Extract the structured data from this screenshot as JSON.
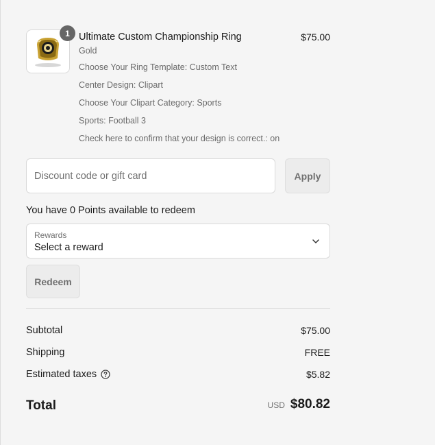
{
  "product": {
    "quantity": "1",
    "title": "Ultimate Custom Championship Ring",
    "variant": "Gold",
    "properties": [
      "Choose Your Ring Template: Custom Text",
      "Center Design: Clipart",
      "Choose Your Clipart Category: Sports",
      "Sports: Football 3",
      "Check here to confirm that your design is correct.: on"
    ],
    "price": "$75.00",
    "image_icon": "ring-thumbnail"
  },
  "discount": {
    "placeholder": "Discount code or gift card",
    "value": "",
    "apply_label": "Apply"
  },
  "rewards": {
    "points_text": "You have 0 Points available to redeem",
    "select_label": "Rewards",
    "select_value": "Select a reward",
    "redeem_label": "Redeem"
  },
  "totals": {
    "subtotal_label": "Subtotal",
    "subtotal_value": "$75.00",
    "shipping_label": "Shipping",
    "shipping_value": "FREE",
    "taxes_label": "Estimated taxes",
    "taxes_value": "$5.82",
    "total_label": "Total",
    "currency": "USD",
    "total_value": "$80.82"
  },
  "colors": {
    "background": "#f5f5f5",
    "text": "#1a1a1a",
    "muted": "#6b6b6b",
    "badge": "#666666"
  }
}
